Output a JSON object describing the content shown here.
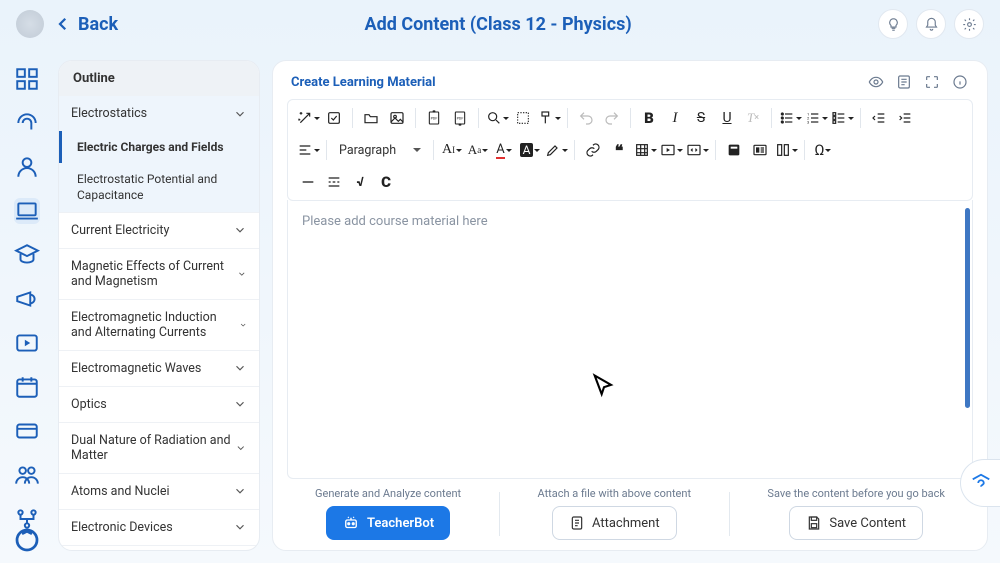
{
  "header": {
    "back": "Back",
    "title": "Add Content (Class 12 - Physics)"
  },
  "outline": {
    "title": "Outline",
    "chapters": [
      {
        "label": "Electrostatics",
        "expanded": true,
        "topics": [
          "Electric Charges and Fields",
          "Electrostatic Potential and Capacitance"
        ],
        "active_topic": 0
      },
      {
        "label": "Current Electricity"
      },
      {
        "label": "Magnetic Effects of Current and Magnetism"
      },
      {
        "label": "Electromagnetic Induction and Alternating Currents"
      },
      {
        "label": "Electromagnetic Waves"
      },
      {
        "label": "Optics"
      },
      {
        "label": "Dual Nature of Radiation and Matter"
      },
      {
        "label": "Atoms and Nuclei"
      },
      {
        "label": "Electronic Devices"
      }
    ]
  },
  "content": {
    "title": "Create Learning Material",
    "placeholder": "Please add course material here",
    "paragraph_label": "Paragraph"
  },
  "footer": {
    "gen_label": "Generate and Analyze content",
    "gen_btn": "TeacherBot",
    "attach_label": "Attach a file with above content",
    "attach_btn": "Attachment",
    "save_label": "Save the content before you go back",
    "save_btn": "Save Content"
  }
}
